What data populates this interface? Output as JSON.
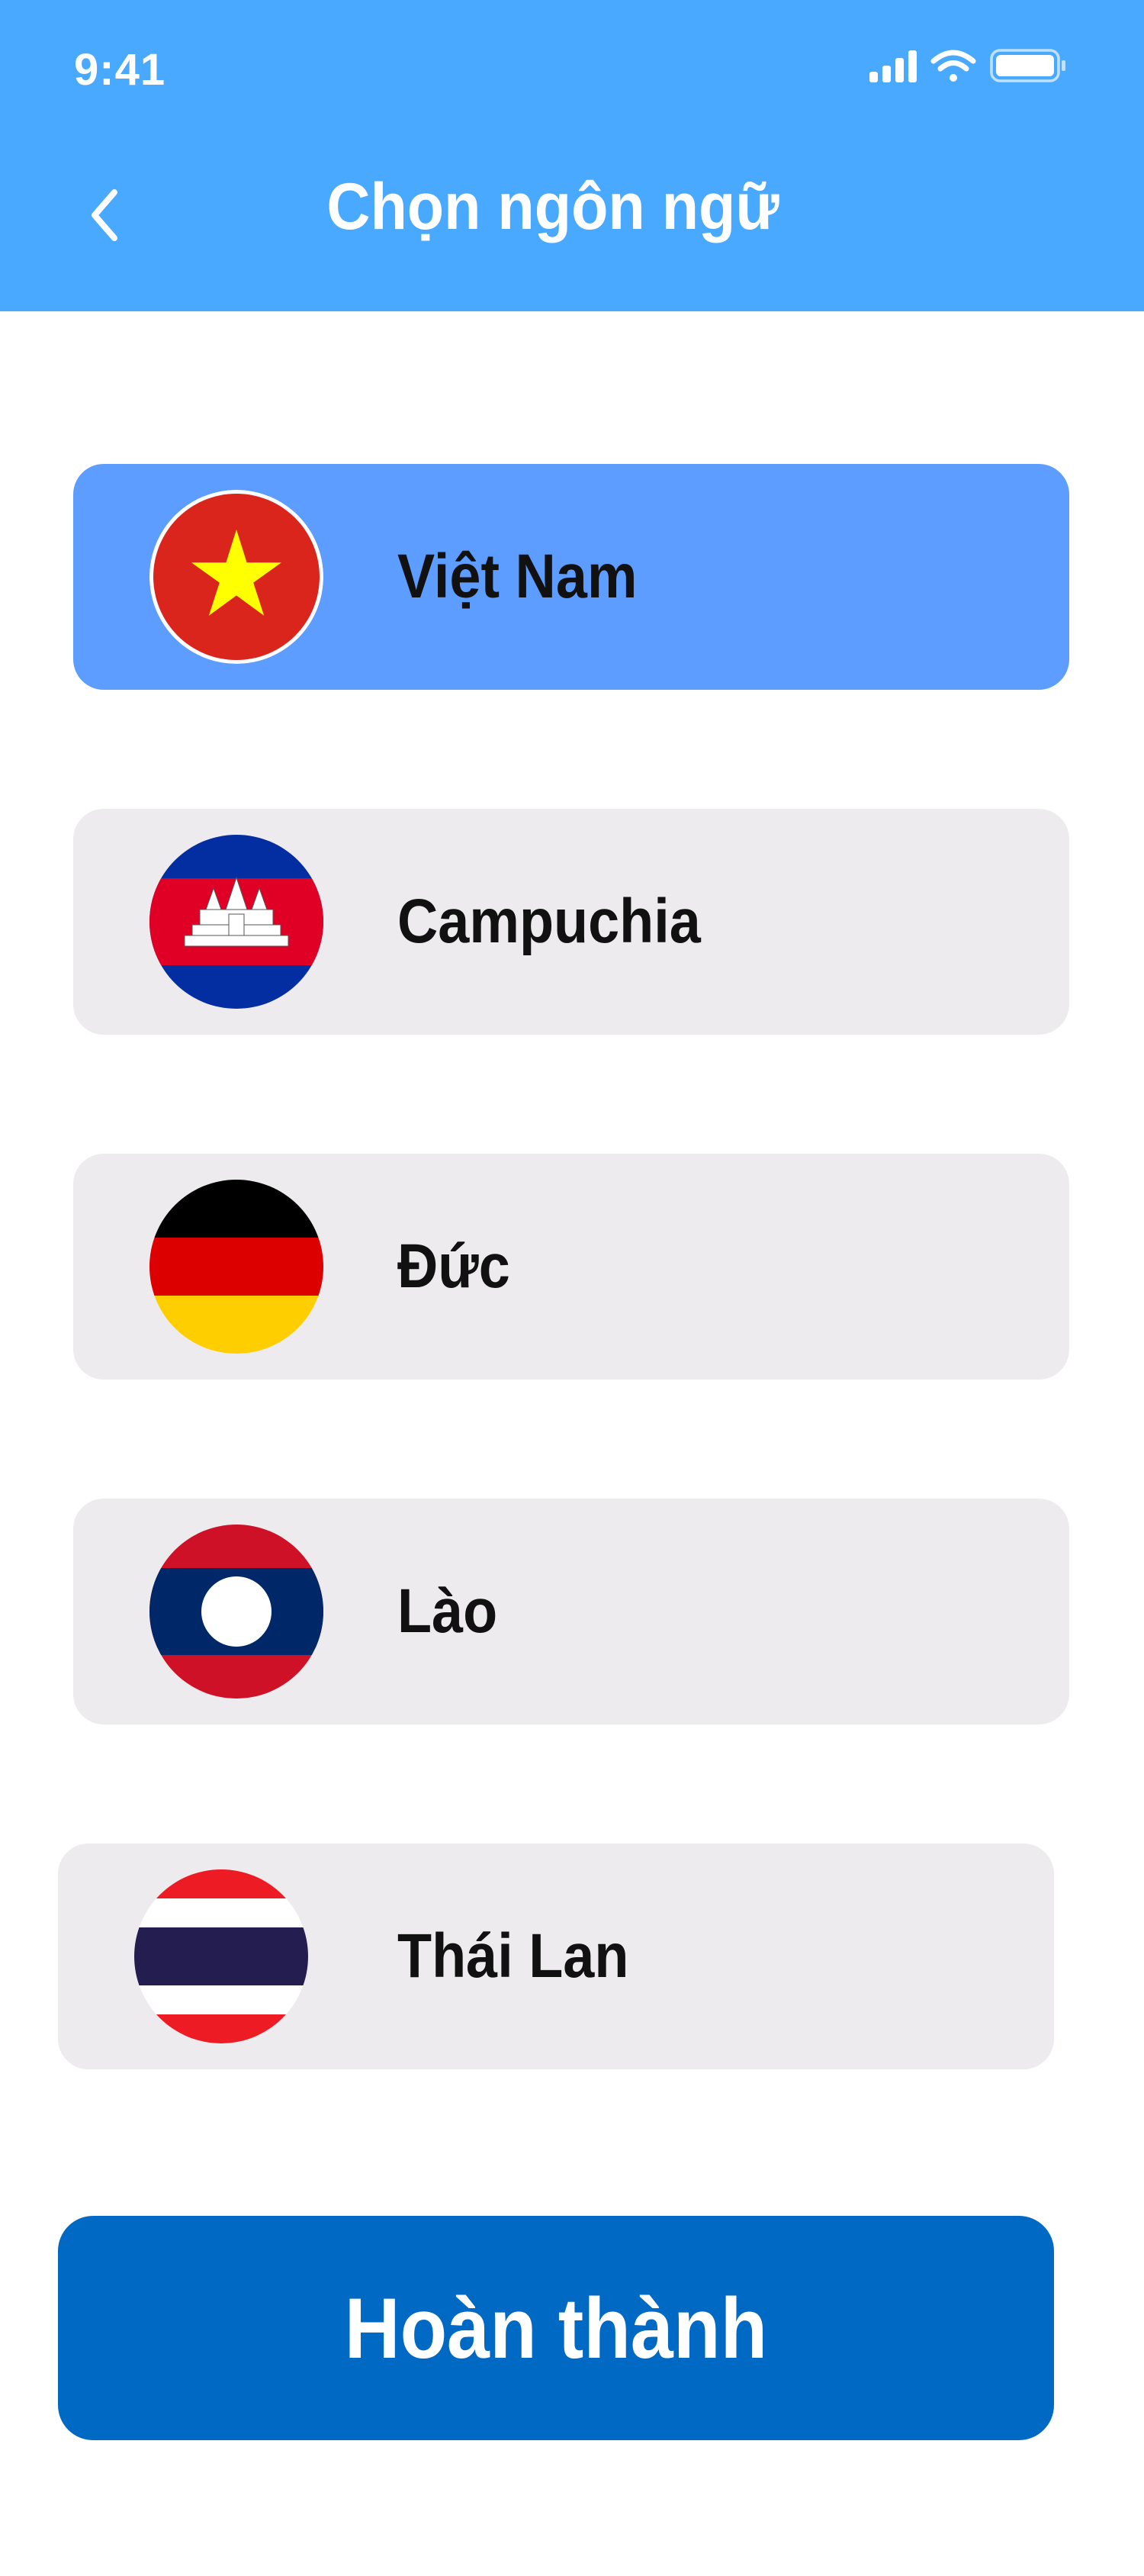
{
  "status_bar": {
    "time": "9:41"
  },
  "header": {
    "title": "Chọn ngôn ngữ",
    "back_icon": "chevron-left-icon"
  },
  "languages": [
    {
      "label": "Việt Nam",
      "flag": "vietnam-flag-icon",
      "selected": true
    },
    {
      "label": "Campuchia",
      "flag": "cambodia-flag-icon",
      "selected": false
    },
    {
      "label": "Đức",
      "flag": "germany-flag-icon",
      "selected": false
    },
    {
      "label": "Lào",
      "flag": "laos-flag-icon",
      "selected": false
    },
    {
      "label": "Thái Lan",
      "flag": "thailand-flag-icon",
      "selected": false
    }
  ],
  "done_button": {
    "label": "Hoàn thành"
  },
  "colors": {
    "header_bg": "#48a9fe",
    "selected_row": "#5c9dff",
    "row_bg": "#edebed",
    "button_bg": "#0069c4"
  }
}
